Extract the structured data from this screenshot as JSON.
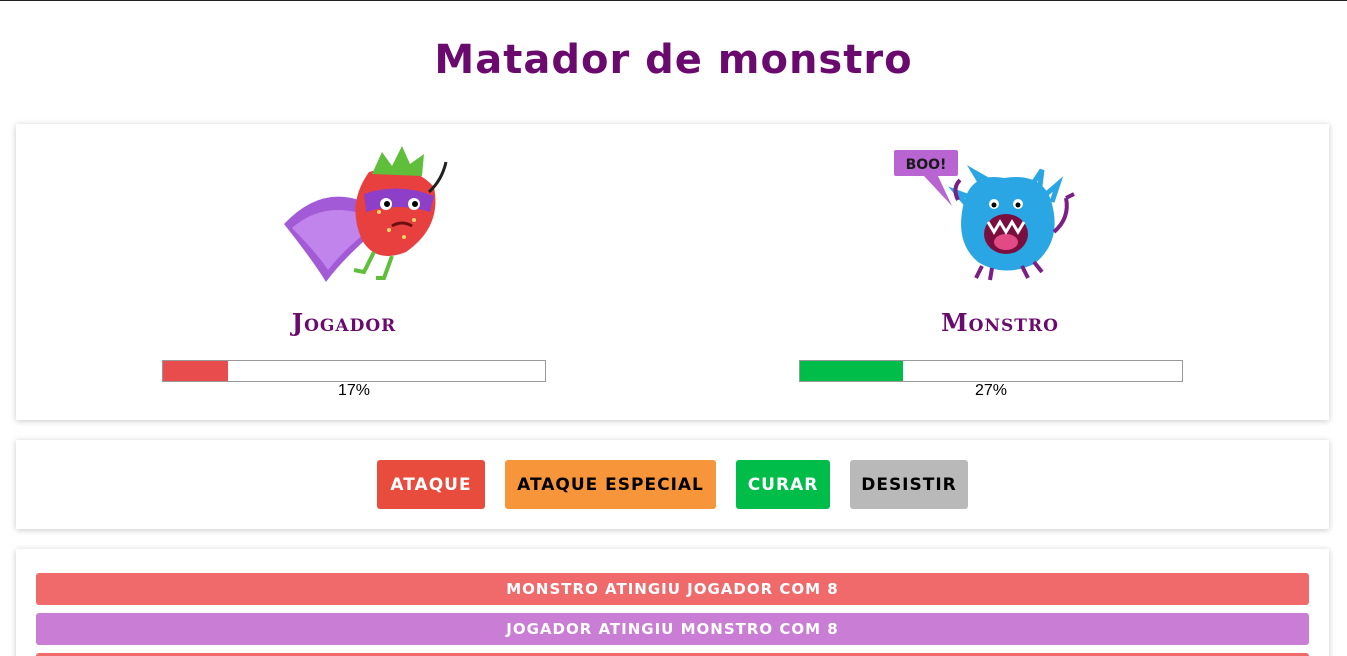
{
  "title": "Matador de monstro",
  "player": {
    "name": "Jogador",
    "health_percent": 17,
    "health_label": "17%",
    "bar_color": "#e84c4c",
    "icon": "strawberry-superhero-icon"
  },
  "monster": {
    "name": "Monstro",
    "health_percent": 27,
    "health_label": "27%",
    "bar_color": "#00bd4a",
    "icon": "blue-monster-icon",
    "speech": "BOO!"
  },
  "controls": {
    "attack": {
      "label": "ATAQUE",
      "color": "#e84c3d"
    },
    "special": {
      "label": "ATAQUE ESPECIAL",
      "color": "#f7953b"
    },
    "heal": {
      "label": "CURAR",
      "color": "#00bd4a"
    },
    "give_up": {
      "label": "DESISTIR",
      "color": "#b9b9b9"
    }
  },
  "log": [
    {
      "text": "MONSTRO ATINGIU JOGADOR COM 8",
      "color": "#f06a6b"
    },
    {
      "text": "JOGADOR ATINGIU MONSTRO COM 8",
      "color": "#c97dd4"
    },
    {
      "text": "",
      "color": "#f06a6b"
    }
  ]
}
